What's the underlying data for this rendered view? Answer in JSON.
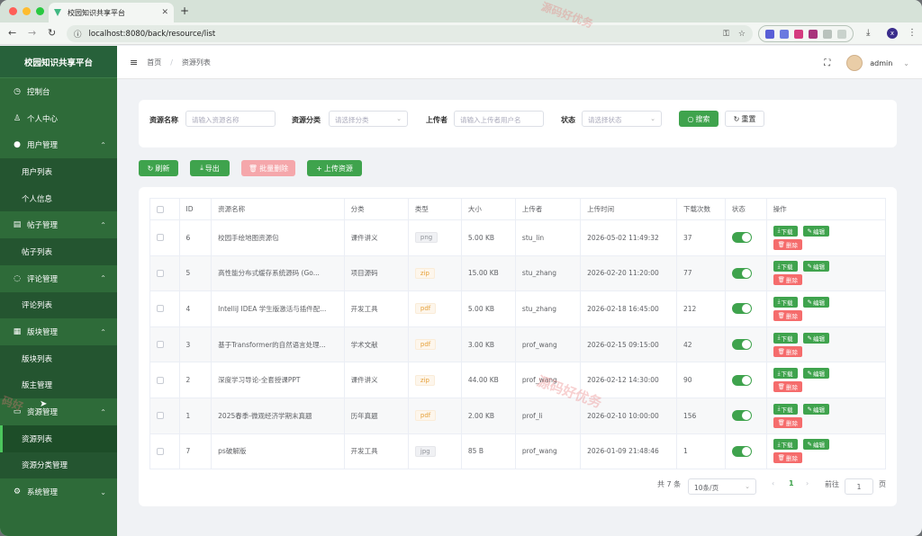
{
  "browser": {
    "tab_title": "校园知识共享平台",
    "url": "localhost:8080/back/resource/list",
    "profile_letter": "x"
  },
  "sidebar": {
    "title": "校园知识共享平台",
    "items": [
      {
        "label": "控制台",
        "type": "top",
        "icon": "dashboard-icon"
      },
      {
        "label": "个人中心",
        "type": "top",
        "icon": "user-icon"
      },
      {
        "label": "用户管理",
        "type": "group",
        "icon": "user-group-icon"
      },
      {
        "label": "用户列表",
        "type": "sub"
      },
      {
        "label": "个人信息",
        "type": "sub"
      },
      {
        "label": "帖子管理",
        "type": "group",
        "icon": "post-icon"
      },
      {
        "label": "帖子列表",
        "type": "sub"
      },
      {
        "label": "评论管理",
        "type": "group",
        "icon": "comment-icon"
      },
      {
        "label": "评论列表",
        "type": "sub"
      },
      {
        "label": "版块管理",
        "type": "group",
        "icon": "grid-icon"
      },
      {
        "label": "版块列表",
        "type": "sub"
      },
      {
        "label": "版主管理",
        "type": "sub"
      },
      {
        "label": "资源管理",
        "type": "group",
        "icon": "folder-icon"
      },
      {
        "label": "资源列表",
        "type": "sub",
        "active": true
      },
      {
        "label": "资源分类管理",
        "type": "sub"
      },
      {
        "label": "系统管理",
        "type": "top-chev",
        "icon": "gear-icon"
      }
    ]
  },
  "header": {
    "breadcrumb_home": "首页",
    "breadcrumb_sep": "/",
    "breadcrumb_current": "资源列表",
    "username": "admin"
  },
  "filters": {
    "name_label": "资源名称",
    "name_placeholder": "请输入资源名称",
    "category_label": "资源分类",
    "category_placeholder": "请选择分类",
    "uploader_label": "上传者",
    "uploader_placeholder": "请输入上传者用户名",
    "status_label": "状态",
    "status_placeholder": "请选择状态",
    "search_btn": "搜索",
    "reset_btn": "重置"
  },
  "toolbar": {
    "refresh": "刷新",
    "export": "导出",
    "batch_delete": "批量删除",
    "upload": "上传资源"
  },
  "table": {
    "columns": [
      "ID",
      "资源名称",
      "分类",
      "类型",
      "大小",
      "上传者",
      "上传时间",
      "下载次数",
      "状态",
      "操作"
    ],
    "rows": [
      {
        "id": "6",
        "name": "校园手绘地图资源包",
        "category": "课件讲义",
        "type": "png",
        "type_style": "info",
        "size": "5.00 KB",
        "uploader": "stu_lin",
        "time": "2026-05-02 11:49:32",
        "downloads": "37"
      },
      {
        "id": "5",
        "name": "高性能分布式缓存系统源码 (Go...",
        "category": "项目源码",
        "type": "zip",
        "type_style": "warn",
        "size": "15.00 KB",
        "uploader": "stu_zhang",
        "time": "2026-02-20 11:20:00",
        "downloads": "77"
      },
      {
        "id": "4",
        "name": "IntelliJ IDEA 学生版激活与插件配...",
        "category": "开发工具",
        "type": "pdf",
        "type_style": "warn",
        "size": "5.00 KB",
        "uploader": "stu_zhang",
        "time": "2026-02-18 16:45:00",
        "downloads": "212"
      },
      {
        "id": "3",
        "name": "基于Transformer的自然语言处理...",
        "category": "学术文献",
        "type": "pdf",
        "type_style": "warn",
        "size": "3.00 KB",
        "uploader": "prof_wang",
        "time": "2026-02-15 09:15:00",
        "downloads": "42"
      },
      {
        "id": "2",
        "name": "深度学习导论-全套授课PPT",
        "category": "课件讲义",
        "type": "zip",
        "type_style": "warn",
        "size": "44.00 KB",
        "uploader": "prof_wang",
        "time": "2026-02-12 14:30:00",
        "downloads": "90"
      },
      {
        "id": "1",
        "name": "2025春季-微观经济学期末真题",
        "category": "历年真题",
        "type": "pdf",
        "type_style": "warn",
        "size": "2.00 KB",
        "uploader": "prof_li",
        "time": "2026-02-10 10:00:00",
        "downloads": "156"
      },
      {
        "id": "7",
        "name": "ps破解版",
        "category": "开发工具",
        "type": "jpg",
        "type_style": "info",
        "size": "85 B",
        "uploader": "prof_wang",
        "time": "2026-01-09 21:48:46",
        "downloads": "1"
      }
    ],
    "op_download": "下载",
    "op_edit": "编辑",
    "op_delete": "删除"
  },
  "pager": {
    "total": "共 7 条",
    "page_size": "10条/页",
    "current": "1",
    "goto_prefix": "前往",
    "goto_value": "1",
    "goto_suffix": "页"
  },
  "watermark": "源码好优务"
}
